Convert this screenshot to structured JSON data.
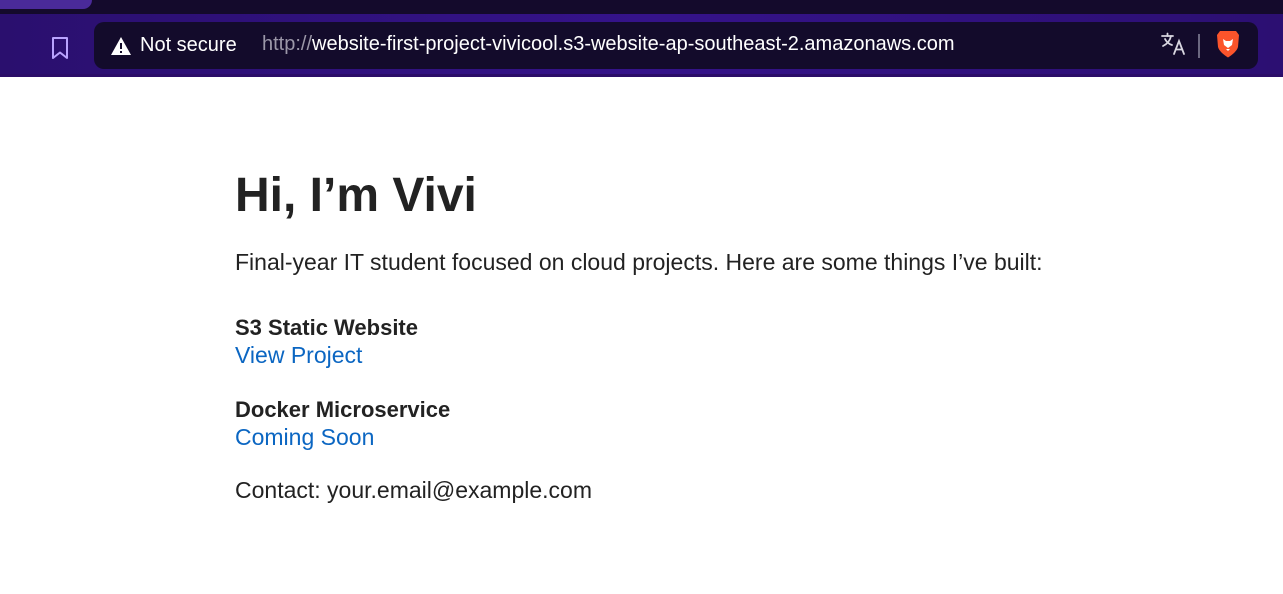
{
  "browser": {
    "security_label": "Not secure",
    "url_scheme": "http://",
    "url_host": "website-first-project-vivicool.s3-website-ap-southeast-2.amazonaws.com",
    "icons": {
      "bookmark": "bookmark-icon",
      "warning": "warning-icon",
      "translate": "translate-icon",
      "brave_shields": "brave-shields-icon"
    },
    "colors": {
      "toolbar": "#35138a",
      "omnibox": "#130b2b",
      "bookmark_icon": "#b9a3ff",
      "brave_orange": "#fb542b"
    }
  },
  "page": {
    "heading": "Hi, I’m Vivi",
    "intro": "Final-year IT student focused on cloud projects. Here are some things I’ve built:",
    "projects": [
      {
        "title": "S3 Static Website",
        "link_label": "View Project"
      },
      {
        "title": "Docker Microservice",
        "link_label": "Coming Soon"
      }
    ],
    "contact": "Contact: your.email@example.com",
    "colors": {
      "text": "#222222",
      "link": "#0b66c2"
    }
  }
}
